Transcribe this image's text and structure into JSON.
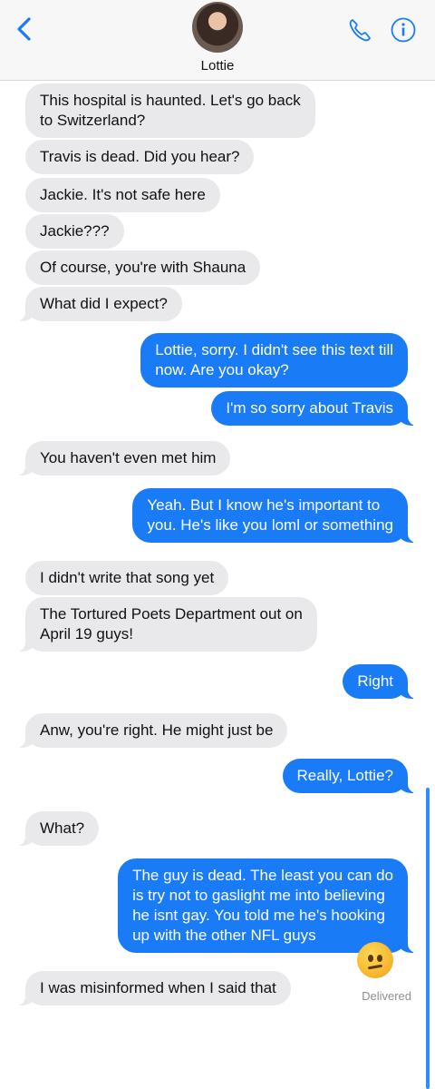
{
  "header": {
    "contact_name": "Lottie",
    "icons": {
      "back": "back-chevron-icon",
      "phone": "phone-icon",
      "info": "info-icon"
    },
    "accent": "#1a7bf6"
  },
  "messages": [
    {
      "from": "them",
      "lines": [
        "This hospital is haunted. Let's go back",
        "to Switzerland?"
      ]
    },
    {
      "from": "them",
      "lines": [
        "Travis is dead. Did you hear?"
      ]
    },
    {
      "from": "them",
      "lines": [
        "Jackie. It's not safe here"
      ]
    },
    {
      "from": "them",
      "lines": [
        "Jackie???"
      ]
    },
    {
      "from": "them",
      "lines": [
        "Of course, you're with Shauna"
      ]
    },
    {
      "from": "them",
      "lines": [
        "What did I expect?"
      ]
    },
    {
      "from": "me",
      "lines": [
        "Lottie, sorry. I didn't see this text till",
        "now. Are you okay?"
      ]
    },
    {
      "from": "me",
      "lines": [
        "I'm so sorry about Travis"
      ]
    },
    {
      "from": "them",
      "lines": [
        "You haven't even met him"
      ]
    },
    {
      "from": "me",
      "lines": [
        "Yeah. But I know he's important to",
        "you. He's like you loml or something"
      ]
    },
    {
      "from": "them",
      "lines": [
        "I didn't write that song yet"
      ]
    },
    {
      "from": "them",
      "lines": [
        "The Tortured Poets Department out on",
        "April 19 guys!"
      ]
    },
    {
      "from": "me",
      "lines": [
        "Right"
      ]
    },
    {
      "from": "them",
      "lines": [
        "Anw, you're right. He might just be"
      ]
    },
    {
      "from": "me",
      "lines": [
        "Really, Lottie?"
      ]
    },
    {
      "from": "them",
      "lines": [
        "What?"
      ]
    },
    {
      "from": "me",
      "lines": [
        "The guy is dead. The least you can do",
        "is try not to gaslight me into believing",
        "he isnt gay. You told me he's hooking",
        "up with the other NFL guys"
      ]
    },
    {
      "from": "them",
      "lines": [
        "I was misinformed when I said that"
      ]
    }
  ],
  "reaction_emoji": "confused-face-icon",
  "status": {
    "delivered": "Delivered"
  },
  "colors": {
    "incoming": "#e9e9eb",
    "outgoing": "#1a7bf6"
  }
}
